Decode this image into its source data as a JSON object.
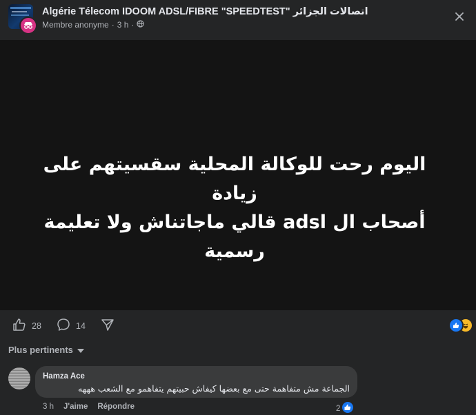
{
  "post": {
    "group_name": "Algérie Télecom IDOOM ADSL/FIBRE \"SPEEDTEST\" اتصالات الجزائر",
    "author": "Membre anonyme",
    "separator": "·",
    "time": "3 h",
    "separator2": "·",
    "privacy_icon": "globe-icon",
    "image_text_line1": "اليوم رحت للوكالة المحلية سقسيتهم على زيادة",
    "image_text_line2": "أصحاب ال adsl قالي ماجاتناش ولا تعليمة رسمية"
  },
  "actions": {
    "like_count": "28",
    "comment_count": "14",
    "share_icon": "share-icon",
    "reaction_icons": [
      "like-reaction-icon",
      "haha-reaction-icon"
    ]
  },
  "comments": {
    "sort_label": "Plus pertinents",
    "items": [
      {
        "author": "Hamza Ace",
        "text": "الجماعة مش متفاهمة حتى مع بعضها كيفاش حبيتهم يتفاهمو مع الشعب هههه",
        "time": "3 h",
        "like_label": "J'aime",
        "reply_label": "Répondre",
        "reaction_count": "2"
      }
    ]
  },
  "colors": {
    "background": "#242526",
    "image_bg": "#141414",
    "bubble": "#3a3b3c",
    "secondary_text": "#b0b3b8",
    "like_blue": "#1877f2",
    "anon_badge": "#d63384"
  }
}
